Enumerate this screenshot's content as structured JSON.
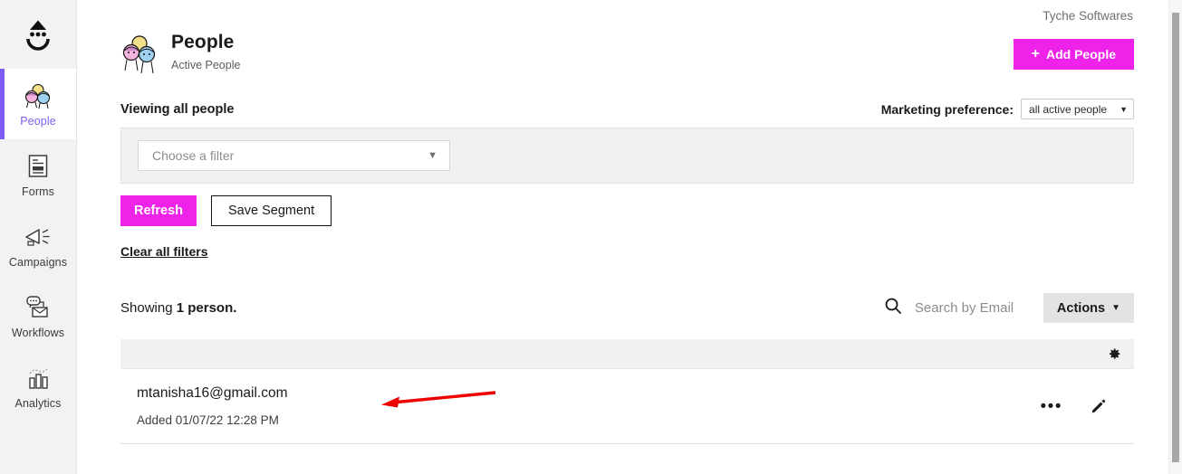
{
  "sidebar": {
    "logo_icon": "drip-smiley-logo",
    "items": [
      {
        "label": "People",
        "icon": "people-icon",
        "active": true
      },
      {
        "label": "Forms",
        "icon": "forms-icon",
        "active": false
      },
      {
        "label": "Campaigns",
        "icon": "megaphone-icon",
        "active": false
      },
      {
        "label": "Workflows",
        "icon": "workflows-icon",
        "active": false
      },
      {
        "label": "Analytics",
        "icon": "bar-chart-icon",
        "active": false
      }
    ],
    "active_color": "#7d5cf6"
  },
  "header": {
    "account_name": "Tyche Softwares",
    "title": "People",
    "subtitle": "Active People",
    "add_people_label": "Add People",
    "add_people_plus": "+",
    "accent_color": "#ee22e8"
  },
  "filters": {
    "viewing_label": "Viewing all people",
    "marketing_preference_label": "Marketing preference:",
    "marketing_preference_value": "all active people",
    "choose_filter_placeholder": "Choose a filter",
    "refresh_label": "Refresh",
    "save_segment_label": "Save Segment",
    "clear_all_filters_label": "Clear all filters"
  },
  "results": {
    "showing_prefix": "Showing ",
    "showing_count": "1 person.",
    "search_placeholder": "Search by Email",
    "search_value": "",
    "search_icon": "search-icon",
    "actions_label": "Actions",
    "actions_caret": "⌄",
    "settings_icon": "gear-icon"
  },
  "table": {
    "rows": [
      {
        "email": "mtanisha16@gmail.com",
        "added": "Added 01/07/22 12:28 PM",
        "more_icon": "ellipsis-icon",
        "edit_icon": "pencil-icon",
        "more_glyph": "•••"
      }
    ]
  },
  "annotation": {
    "type": "red-arrow",
    "color": "#ee0000",
    "points_to": "mtanisha16@gmail.com"
  }
}
